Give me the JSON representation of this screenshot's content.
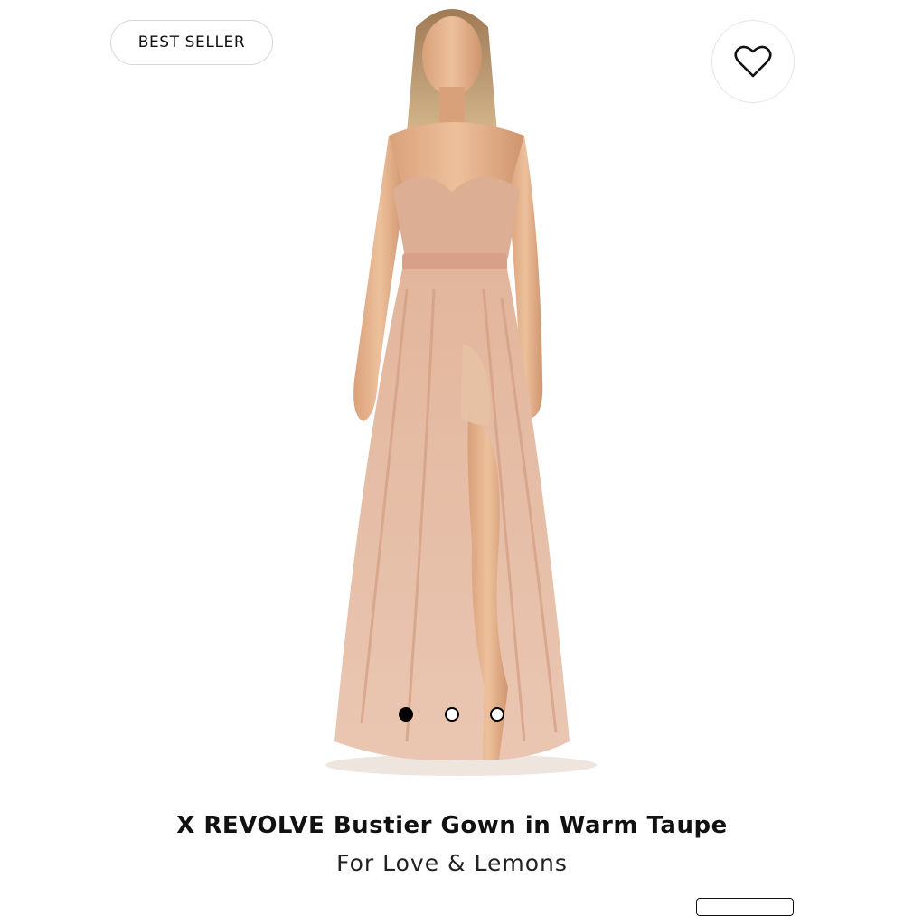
{
  "product": {
    "badge": "BEST SELLER",
    "title": "X REVOLVE Bustier Gown in Warm Taupe",
    "brand": "For Love & Lemons",
    "favorite_icon": "heart-icon",
    "image": {
      "subject": "model wearing bustier gown",
      "dominant_color": "#d9a98f"
    }
  },
  "carousel": {
    "total": 3,
    "active": 1
  },
  "colors": {
    "text": "#111111",
    "badge_border": "#d6d6d6",
    "dot_active": "#000000"
  }
}
